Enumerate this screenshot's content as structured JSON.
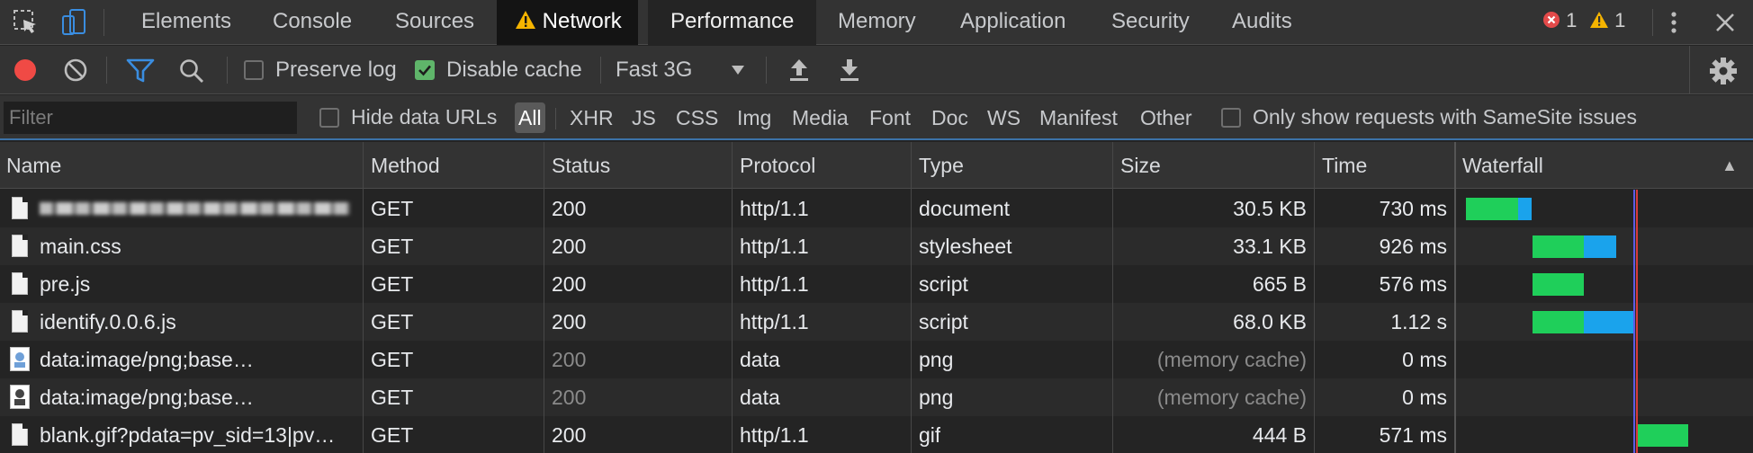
{
  "tabs": {
    "items": [
      {
        "label": "Elements"
      },
      {
        "label": "Console"
      },
      {
        "label": "Sources"
      },
      {
        "label": "Network"
      },
      {
        "label": "Performance"
      },
      {
        "label": "Memory"
      },
      {
        "label": "Application"
      },
      {
        "label": "Security"
      },
      {
        "label": "Audits"
      }
    ],
    "active": "Network",
    "error_count": "1",
    "warning_count": "1"
  },
  "toolbar": {
    "preserve_log_label": "Preserve log",
    "preserve_log_checked": false,
    "disable_cache_label": "Disable cache",
    "disable_cache_checked": true,
    "throttling_value": "Fast 3G"
  },
  "filter": {
    "placeholder": "Filter",
    "value": "",
    "hide_data_urls_label": "Hide data URLs",
    "hide_data_urls_checked": false,
    "types": [
      "All",
      "XHR",
      "JS",
      "CSS",
      "Img",
      "Media",
      "Font",
      "Doc",
      "WS",
      "Manifest",
      "Other"
    ],
    "active_type": "All",
    "samesite_label": "Only show requests with SameSite issues",
    "samesite_checked": false
  },
  "table": {
    "columns": [
      "Name",
      "Method",
      "Status",
      "Protocol",
      "Type",
      "Size",
      "Time",
      "Waterfall"
    ],
    "sort_indicator": "▲",
    "rows": [
      {
        "name": "",
        "name_obscured": true,
        "icon": "document-icon",
        "method": "GET",
        "status": "200",
        "protocol": "http/1.1",
        "type": "document",
        "size": "30.5 KB",
        "time": "730 ms"
      },
      {
        "name": "main.css",
        "icon": "document-icon",
        "method": "GET",
        "status": "200",
        "protocol": "http/1.1",
        "type": "stylesheet",
        "size": "33.1 KB",
        "time": "926 ms"
      },
      {
        "name": "pre.js",
        "icon": "document-icon",
        "method": "GET",
        "status": "200",
        "protocol": "http/1.1",
        "type": "script",
        "size": "665 B",
        "time": "576 ms"
      },
      {
        "name": "identify.0.0.6.js",
        "icon": "document-icon",
        "method": "GET",
        "status": "200",
        "protocol": "http/1.1",
        "type": "script",
        "size": "68.0 KB",
        "time": "1.12 s"
      },
      {
        "name": "data:image/png;base…",
        "icon": "image-icon",
        "method": "GET",
        "status": "200",
        "status_dim": true,
        "protocol": "data",
        "type": "png",
        "size": "(memory cache)",
        "size_dim": true,
        "time": "0 ms"
      },
      {
        "name": "data:image/png;base…",
        "icon": "image-icon",
        "method": "GET",
        "status": "200",
        "status_dim": true,
        "protocol": "data",
        "type": "png",
        "size": "(memory cache)",
        "size_dim": true,
        "time": "0 ms"
      },
      {
        "name": "blank.gif?pdata=pv_sid=13|pv…",
        "icon": "document-icon",
        "method": "GET",
        "status": "200",
        "protocol": "http/1.1",
        "type": "gif",
        "size": "444 B",
        "time": "571 ms"
      }
    ]
  },
  "colors": {
    "record_active": "#f04a45",
    "filter_active": "#3a8de0",
    "waterfall_waiting": "#1fcf5a",
    "waterfall_download": "#1aa3ec",
    "error_badge": "#e34a4a",
    "warning_badge": "#f5b400"
  }
}
